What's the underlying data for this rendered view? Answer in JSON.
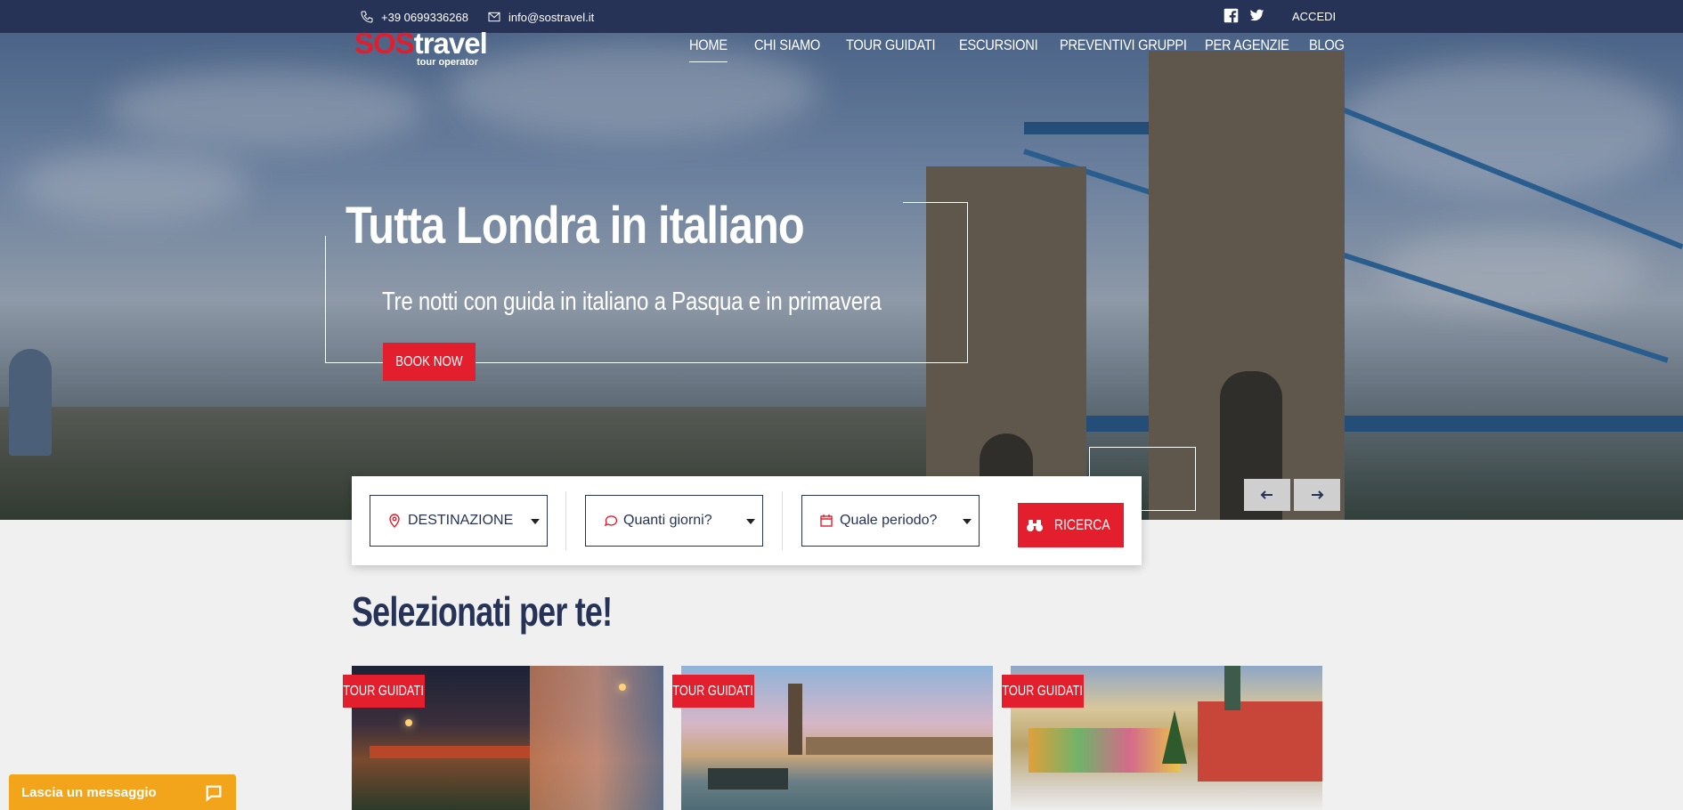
{
  "topbar": {
    "phone": "+39 0699336268",
    "email": "info@sostravel.it",
    "login_label": "ACCEDI",
    "social_icons": [
      "facebook-icon",
      "twitter-icon"
    ]
  },
  "logo": {
    "brand_sos": "SOS",
    "brand_travel": "travel",
    "tagline": "tour operator"
  },
  "nav": {
    "items": [
      {
        "label": "HOME",
        "active": true
      },
      {
        "label": "CHI SIAMO",
        "active": false
      },
      {
        "label": "TOUR GUIDATI",
        "active": false
      },
      {
        "label": "ESCURSIONI",
        "active": false
      },
      {
        "label": "PREVENTIVI GRUPPI",
        "active": false
      },
      {
        "label": "PER AGENZIE",
        "active": false
      },
      {
        "label": "BLOG",
        "active": false
      }
    ]
  },
  "hero": {
    "title": "Tutta Londra in italiano",
    "subtitle": "Tre notti con guida in italiano a Pasqua e in primavera",
    "cta_label": "BOOK NOW",
    "prev_icon": "arrow-left-icon",
    "next_icon": "arrow-right-icon"
  },
  "search": {
    "destination_label": "DESTINAZIONE",
    "days_placeholder": "Quanti giorni?",
    "period_placeholder": "Quale periodo?",
    "button_label": "RICERCA"
  },
  "section": {
    "title_light": "Selezionati ",
    "title_bold": "per te!"
  },
  "cards": [
    {
      "tag": "TOUR GUIDATI"
    },
    {
      "tag": "TOUR GUIDATI"
    },
    {
      "tag": "TOUR GUIDATI"
    }
  ],
  "chat": {
    "label": "Lascia un messaggio"
  },
  "colors": {
    "navy": "#263357",
    "accent_red": "#e31e2d",
    "chat_orange": "#f2a51a"
  }
}
